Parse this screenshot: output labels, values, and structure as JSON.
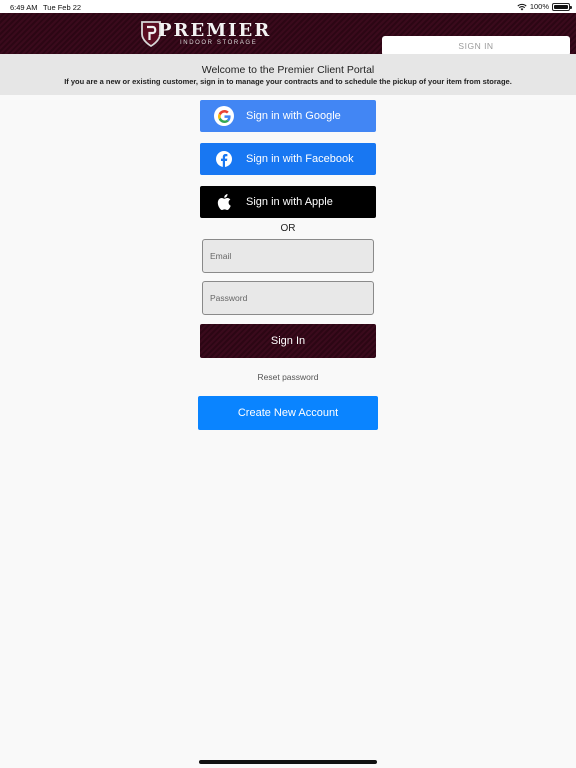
{
  "status": {
    "time": "6:49 AM",
    "date": "Tue Feb 22",
    "battery": "100%",
    "battery_level": 1.0
  },
  "header": {
    "logo_main": "PREMIER",
    "logo_sub": "INDOOR STORAGE",
    "signin_label": "SIGN IN",
    "colors": {
      "brand": "#3a0a1c"
    }
  },
  "banner": {
    "title": "Welcome to the Premier Client Portal",
    "subtitle": "If you are a new or existing customer, sign in to manage your contracts and to schedule the pickup of your item from storage."
  },
  "auth": {
    "google_label": "Sign in with Google",
    "facebook_label": "Sign in with Facebook",
    "apple_label": "Sign in with Apple",
    "or_label": "OR",
    "email_placeholder": "Email",
    "password_placeholder": "Password",
    "signin_label": "Sign In",
    "reset_label": "Reset password",
    "create_label": "Create New Account",
    "colors": {
      "google": "#4286f4",
      "facebook": "#1877f2",
      "apple": "#000000",
      "create": "#0a84ff"
    }
  },
  "icons": [
    "wifi-icon",
    "battery-icon",
    "shield-logo-icon",
    "google-icon",
    "facebook-icon",
    "apple-icon"
  ]
}
